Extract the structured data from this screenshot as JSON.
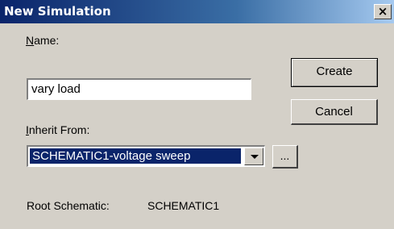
{
  "window": {
    "title": "New Simulation",
    "close_label": "×"
  },
  "form": {
    "name_label_first": "N",
    "name_label_rest": "ame:",
    "name_value": "vary load",
    "inherit_label_first": "I",
    "inherit_label_rest": "nherit From:",
    "inherit_selected": "SCHEMATIC1-voltage sweep",
    "root_label": "Root Schematic:",
    "root_value": "SCHEMATIC1"
  },
  "buttons": {
    "create": "Create",
    "cancel": "Cancel",
    "browse": "..."
  },
  "icons": {
    "dropdown": "chevron-down-icon",
    "close": "close-icon"
  },
  "colors": {
    "title_bar": "#0a246a",
    "dialog_bg": "#d4d0c8",
    "selection": "#0a246a"
  }
}
